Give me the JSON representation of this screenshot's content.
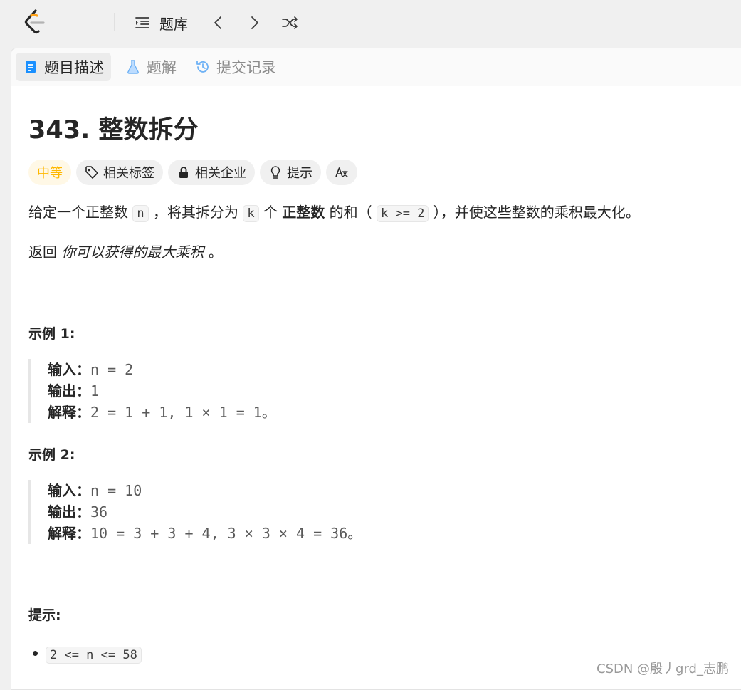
{
  "topbar": {
    "logo_icon": "leetcode-logo-icon",
    "problem_list_label": "题库"
  },
  "tabs": [
    {
      "label": "题目描述",
      "icon": "description-icon"
    },
    {
      "label": "题解",
      "icon": "flask-icon"
    },
    {
      "label": "提交记录",
      "icon": "history-icon"
    }
  ],
  "problem": {
    "title": "343. 整数拆分",
    "difficulty": "中等",
    "tags": [
      "相关标签",
      "相关企业",
      "提示"
    ],
    "desc": {
      "p1": "给定一个正整数",
      "code_n": "n",
      "p2": "，将其拆分为",
      "code_k": "k",
      "p3": "个",
      "bold": "正整数",
      "p4": "的和（",
      "code_cond": "k >= 2",
      "p5": "），并使这些整数的乘积最大化。"
    },
    "return_prefix": "返回",
    "return_italic": "你可以获得的最大乘积",
    "return_suffix": "。",
    "examples": [
      {
        "heading": "示例 1:",
        "input_label": "输入：",
        "input": "n = 2",
        "output_label": "输出：",
        "output": "1",
        "explain_label": "解释：",
        "explain": "2 = 1 + 1, 1 × 1 = 1。"
      },
      {
        "heading": "示例 2:",
        "input_label": "输入：",
        "input": "n = 10",
        "output_label": "输出：",
        "output": "36",
        "explain_label": "解释：",
        "explain": "10 = 3 + 3 + 4, 3 × 3 × 4 = 36。"
      }
    ],
    "constraints_heading": "提示:",
    "constraints": [
      "2 <= n <= 58"
    ]
  },
  "colors": {
    "difficulty_medium": "#ffb800",
    "active_tab_icon": "#1a90ff"
  },
  "watermark": "CSDN @殷丿grd_志鹏"
}
